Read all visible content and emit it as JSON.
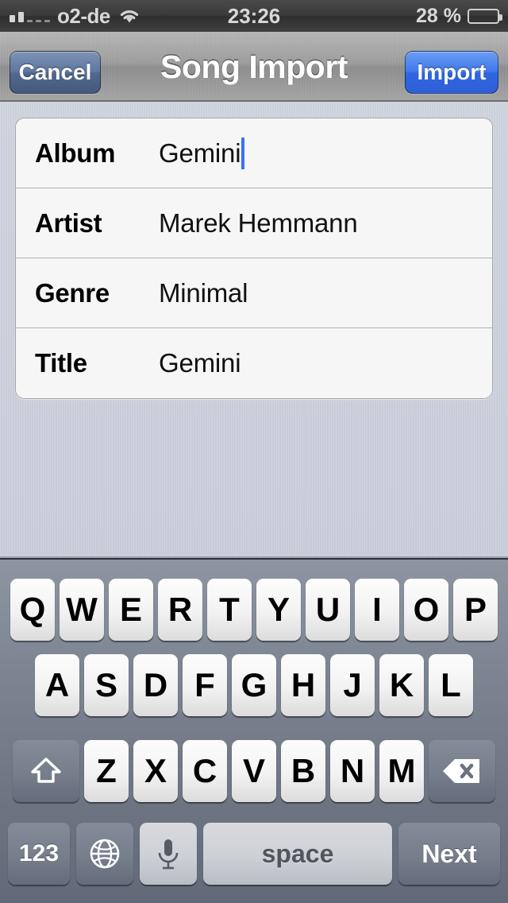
{
  "status_bar": {
    "carrier": "o2-de",
    "signal_bars_filled": 2,
    "signal_bars_total": 5,
    "wifi_icon": "wifi-icon",
    "time": "23:26",
    "battery_text": "28 %",
    "battery_percent": 28
  },
  "nav_bar": {
    "title": "Song Import",
    "cancel_label": "Cancel",
    "import_label": "Import",
    "cancel_color": "#5f779e",
    "import_color": "#3f78ea"
  },
  "form": {
    "rows": [
      {
        "label": "Album",
        "value": "Gemini",
        "focused": true
      },
      {
        "label": "Artist",
        "value": "Marek Hemmann",
        "focused": false
      },
      {
        "label": "Genre",
        "value": "Minimal",
        "focused": false
      },
      {
        "label": "Title",
        "value": "Gemini",
        "focused": false
      }
    ],
    "caret_color": "#3c72f0"
  },
  "keyboard": {
    "row1": [
      "Q",
      "W",
      "E",
      "R",
      "T",
      "Y",
      "U",
      "I",
      "O",
      "P"
    ],
    "row2": [
      "A",
      "S",
      "D",
      "F",
      "G",
      "H",
      "J",
      "K",
      "L"
    ],
    "row3": [
      "Z",
      "X",
      "C",
      "V",
      "B",
      "N",
      "M"
    ],
    "shift_icon": "shift-arrow-icon",
    "backspace_icon": "backspace-icon",
    "numbers_label": "123",
    "globe_icon": "globe-icon",
    "microphone_icon": "microphone-icon",
    "space_label": "space",
    "next_label": "Next"
  }
}
